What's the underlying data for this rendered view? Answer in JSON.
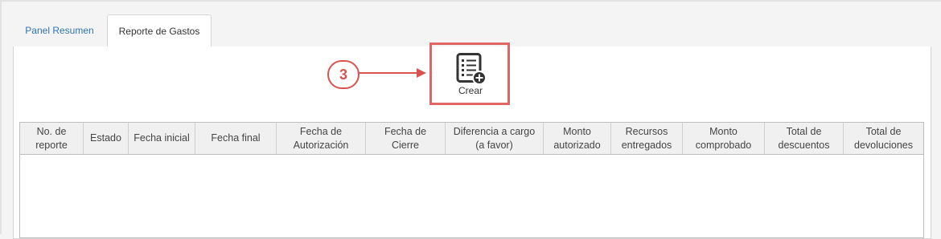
{
  "tabs": [
    {
      "label": "Panel Resumen"
    },
    {
      "label": "Reporte de Gastos"
    }
  ],
  "toolbar": {
    "step_number": "3",
    "crear_label": "Crear"
  },
  "table": {
    "columns": [
      "No. de\nreporte",
      "Estado",
      "Fecha inicial",
      "Fecha final",
      "Fecha de\nAutorización",
      "Fecha de\nCierre",
      "Diferencia a cargo\n(a favor)",
      "Monto\nautorizado",
      "Recursos\nentregados",
      "Monto\ncomprobado",
      "Total de\ndescuentos",
      "Total de\ndevoluciones"
    ],
    "rows": []
  },
  "colors": {
    "highlight": "#e06666",
    "step": "#d9534f",
    "tab_link": "#2f74b5"
  },
  "icons": {
    "crear": "add-document-icon",
    "arrow": "right-arrow-icon"
  }
}
